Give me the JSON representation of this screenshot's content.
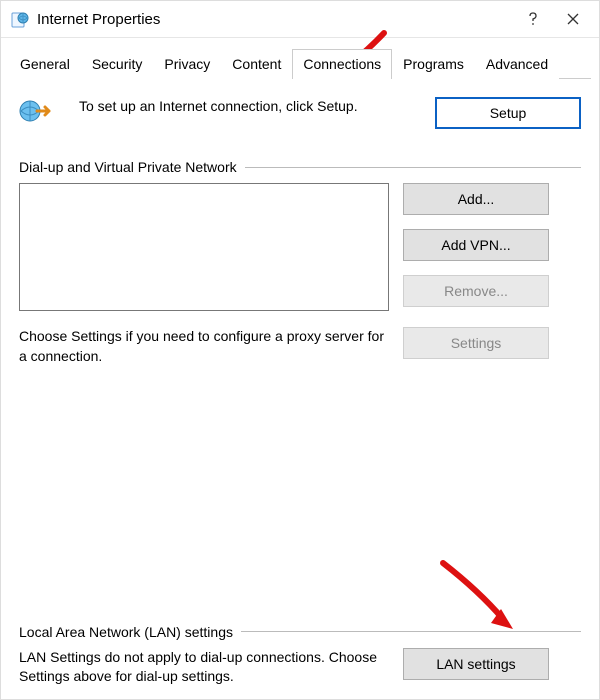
{
  "window": {
    "title": "Internet Properties"
  },
  "tabs": {
    "items": [
      {
        "label": "General"
      },
      {
        "label": "Security"
      },
      {
        "label": "Privacy"
      },
      {
        "label": "Content"
      },
      {
        "label": "Connections"
      },
      {
        "label": "Programs"
      },
      {
        "label": "Advanced"
      }
    ],
    "active_index": 4
  },
  "setup": {
    "text": "To set up an Internet connection, click Setup.",
    "button": "Setup"
  },
  "dialup": {
    "heading": "Dial-up and Virtual Private Network",
    "buttons": {
      "add": "Add...",
      "add_vpn": "Add VPN...",
      "remove": "Remove..."
    },
    "choose_text": "Choose Settings if you need to configure a proxy server for a connection.",
    "settings_button": "Settings"
  },
  "lan": {
    "heading": "Local Area Network (LAN) settings",
    "note": "LAN Settings do not apply to dial-up connections. Choose Settings above for dial-up settings.",
    "button": "LAN settings"
  }
}
